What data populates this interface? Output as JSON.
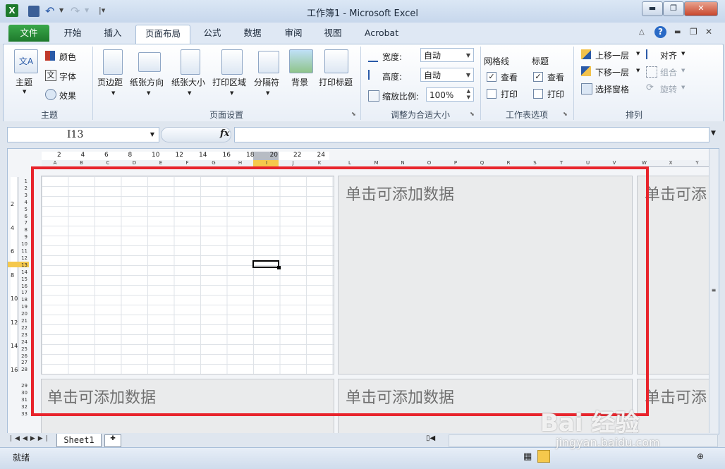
{
  "window": {
    "title": "工作簿1 - Microsoft Excel"
  },
  "tabs": [
    "文件",
    "开始",
    "插入",
    "页面布局",
    "公式",
    "数据",
    "审阅",
    "视图",
    "Acrobat"
  ],
  "ribbon": {
    "themes": {
      "label": "主题",
      "btn": "主题",
      "colors": "颜色",
      "fonts": "字体",
      "effects": "效果"
    },
    "page_setup": {
      "label": "页面设置",
      "margins": "页边距",
      "orientation": "纸张方向",
      "size": "纸张大小",
      "print_area": "打印区域",
      "breaks": "分隔符",
      "background": "背景",
      "print_titles": "打印标题"
    },
    "scale": {
      "label": "调整为合适大小",
      "width_label": "宽度:",
      "width_value": "自动",
      "height_label": "高度:",
      "height_value": "自动",
      "zoom_label": "缩放比例:",
      "zoom_value": "100%"
    },
    "sheet_options": {
      "label": "工作表选项",
      "gridlines": "网格线",
      "headings": "标题",
      "view": "查看",
      "print": "打印"
    },
    "arrange": {
      "label": "排列",
      "bring_forward": "上移一层",
      "send_backward": "下移一层",
      "selection_pane": "选择窗格",
      "align": "对齐",
      "group": "组合",
      "rotate": "旋转"
    }
  },
  "formula": {
    "name_box": "I13",
    "fx": "fx"
  },
  "sheet": {
    "placeholder": "单击可添加数据",
    "placeholder_partial": "单击可添",
    "selected_col": "I",
    "selected_row": "13",
    "ruler_numbers": [
      "2",
      "4",
      "6",
      "8",
      "10",
      "12",
      "14",
      "16",
      "18",
      "20",
      "22",
      "24"
    ],
    "v_ruler_numbers": [
      "2",
      "4",
      "6",
      "8",
      "10",
      "12",
      "14",
      "16"
    ],
    "col_headers": [
      "A",
      "B",
      "C",
      "D",
      "E",
      "F",
      "G",
      "H",
      "I",
      "J",
      "K",
      "L",
      "M",
      "N",
      "O",
      "P",
      "Q",
      "R",
      "S",
      "T",
      "U",
      "V",
      "W",
      "X",
      "Y"
    ],
    "rows": [
      "1",
      "2",
      "3",
      "4",
      "5",
      "6",
      "7",
      "8",
      "9",
      "10",
      "11",
      "12",
      "13",
      "14",
      "15",
      "16",
      "17",
      "18",
      "19",
      "20",
      "21",
      "22",
      "23",
      "24",
      "25",
      "26",
      "27",
      "28",
      "29",
      "30",
      "31",
      "32",
      "33"
    ]
  },
  "sheet_tabs": {
    "sheet1": "Sheet1"
  },
  "status": {
    "ready": "就绪"
  },
  "watermark": {
    "brand": "Bai 经验",
    "url": "jingyan.baidu.com"
  }
}
